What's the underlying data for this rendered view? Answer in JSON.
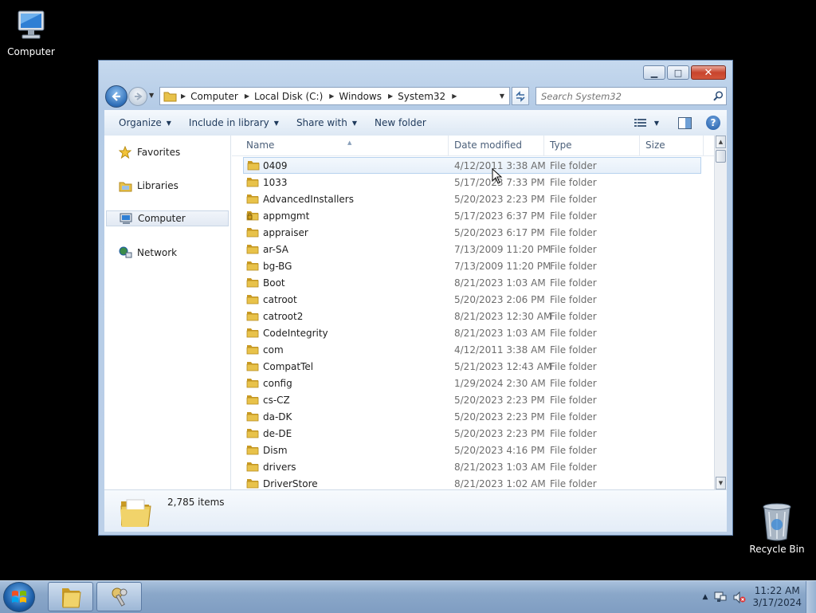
{
  "desktop": {
    "icons": [
      {
        "label": "Computer",
        "icon": "computer-icon"
      },
      {
        "label": "Recycle Bin",
        "icon": "recycle-bin-icon"
      }
    ]
  },
  "window": {
    "caption_buttons": {
      "minimize": "▁",
      "maximize": "□",
      "close": "✕"
    },
    "breadcrumbs": [
      "Computer",
      "Local Disk (C:)",
      "Windows",
      "System32"
    ],
    "search_placeholder": "Search System32",
    "toolbar": {
      "organize": "Organize",
      "include_in_library": "Include in library",
      "share_with": "Share with",
      "new_folder": "New folder",
      "help": "?"
    },
    "nav_pane": {
      "favorites": "Favorites",
      "libraries": "Libraries",
      "computer": "Computer",
      "network": "Network"
    },
    "columns": {
      "name": "Name",
      "date_modified": "Date modified",
      "type": "Type",
      "size": "Size"
    },
    "files": [
      {
        "name": "0409",
        "date": "4/12/2011 3:38 AM",
        "type": "File folder",
        "locked": false
      },
      {
        "name": "1033",
        "date": "5/17/2023 7:33 PM",
        "type": "File folder",
        "locked": false
      },
      {
        "name": "AdvancedInstallers",
        "date": "5/20/2023 2:23 PM",
        "type": "File folder",
        "locked": false
      },
      {
        "name": "appmgmt",
        "date": "5/17/2023 6:37 PM",
        "type": "File folder",
        "locked": true
      },
      {
        "name": "appraiser",
        "date": "5/20/2023 6:17 PM",
        "type": "File folder",
        "locked": false
      },
      {
        "name": "ar-SA",
        "date": "7/13/2009 11:20 PM",
        "type": "File folder",
        "locked": false
      },
      {
        "name": "bg-BG",
        "date": "7/13/2009 11:20 PM",
        "type": "File folder",
        "locked": false
      },
      {
        "name": "Boot",
        "date": "8/21/2023 1:03 AM",
        "type": "File folder",
        "locked": false
      },
      {
        "name": "catroot",
        "date": "5/20/2023 2:06 PM",
        "type": "File folder",
        "locked": false
      },
      {
        "name": "catroot2",
        "date": "8/21/2023 12:30 AM",
        "type": "File folder",
        "locked": false
      },
      {
        "name": "CodeIntegrity",
        "date": "8/21/2023 1:03 AM",
        "type": "File folder",
        "locked": false
      },
      {
        "name": "com",
        "date": "4/12/2011 3:38 AM",
        "type": "File folder",
        "locked": false
      },
      {
        "name": "CompatTel",
        "date": "5/21/2023 12:43 AM",
        "type": "File folder",
        "locked": false
      },
      {
        "name": "config",
        "date": "1/29/2024 2:30 AM",
        "type": "File folder",
        "locked": false
      },
      {
        "name": "cs-CZ",
        "date": "5/20/2023 2:23 PM",
        "type": "File folder",
        "locked": false
      },
      {
        "name": "da-DK",
        "date": "5/20/2023 2:23 PM",
        "type": "File folder",
        "locked": false
      },
      {
        "name": "de-DE",
        "date": "5/20/2023 2:23 PM",
        "type": "File folder",
        "locked": false
      },
      {
        "name": "Dism",
        "date": "5/20/2023 4:16 PM",
        "type": "File folder",
        "locked": false
      },
      {
        "name": "drivers",
        "date": "8/21/2023 1:03 AM",
        "type": "File folder",
        "locked": false
      },
      {
        "name": "DriverStore",
        "date": "8/21/2023 1:02 AM",
        "type": "File folder",
        "locked": false
      }
    ],
    "status": {
      "item_count": "2,785 items"
    }
  },
  "taskbar": {
    "clock_time": "11:22 AM",
    "clock_date": "3/17/2024"
  },
  "colors": {
    "folder": "#e8c24a",
    "folder_dark": "#c99a23",
    "hover_row_border": "#b8d2ee",
    "taskbar": "#8aa7c9"
  }
}
